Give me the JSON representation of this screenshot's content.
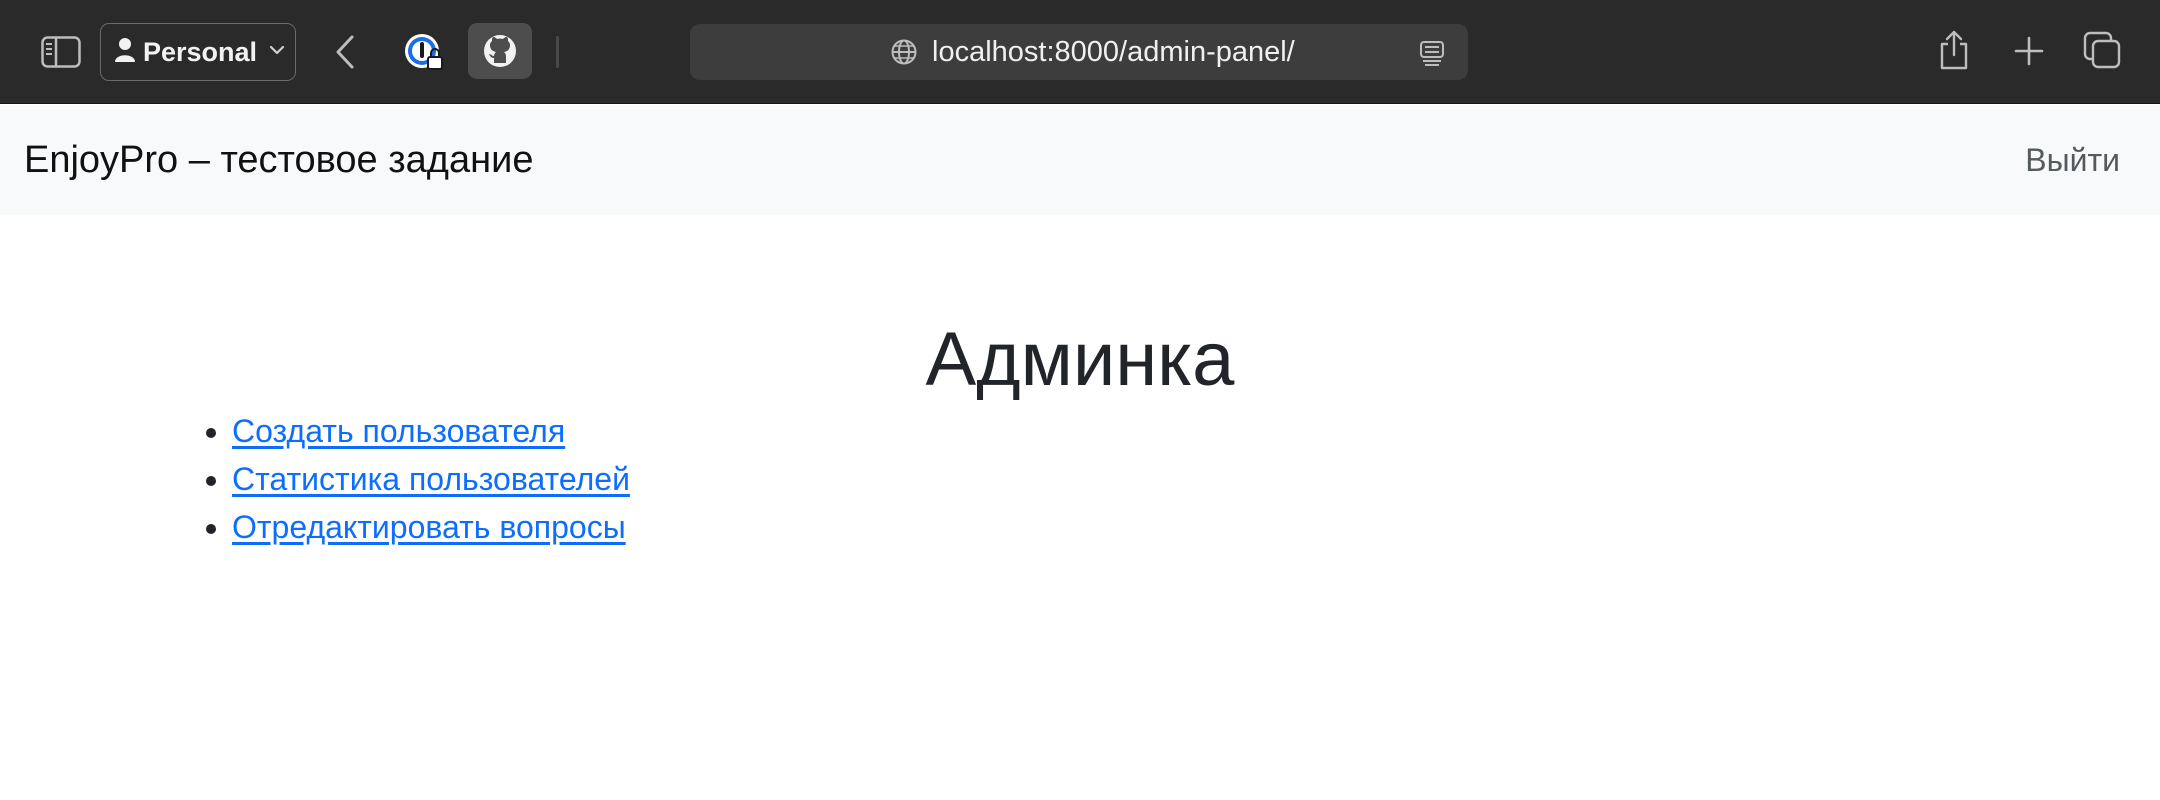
{
  "browser": {
    "profile_label": "Personal",
    "url": "localhost:8000/admin-panel/",
    "icons": {
      "sidebar": "sidebar-icon",
      "profile": "person-icon",
      "back": "chevron-left-icon",
      "extension_1": "onepassword-icon",
      "extension_2": "github-icon",
      "globe": "globe-icon",
      "reader": "reader-mode-icon",
      "share": "share-icon",
      "new_tab": "plus-icon",
      "tabs": "tab-overview-icon"
    },
    "colors": {
      "toolbar_bg": "#2a2a2a",
      "address_bg": "#3d3d3d"
    }
  },
  "navbar": {
    "brand": "EnjoyPro – тестовое задание",
    "logout_label": "Выйти",
    "bg": "#f8f9fa"
  },
  "main": {
    "title": "Админка",
    "links": [
      {
        "label": "Создать пользователя"
      },
      {
        "label": "Статистика пользователей"
      },
      {
        "label": "Отредактировать вопросы"
      }
    ],
    "link_color": "#0d6efd"
  }
}
